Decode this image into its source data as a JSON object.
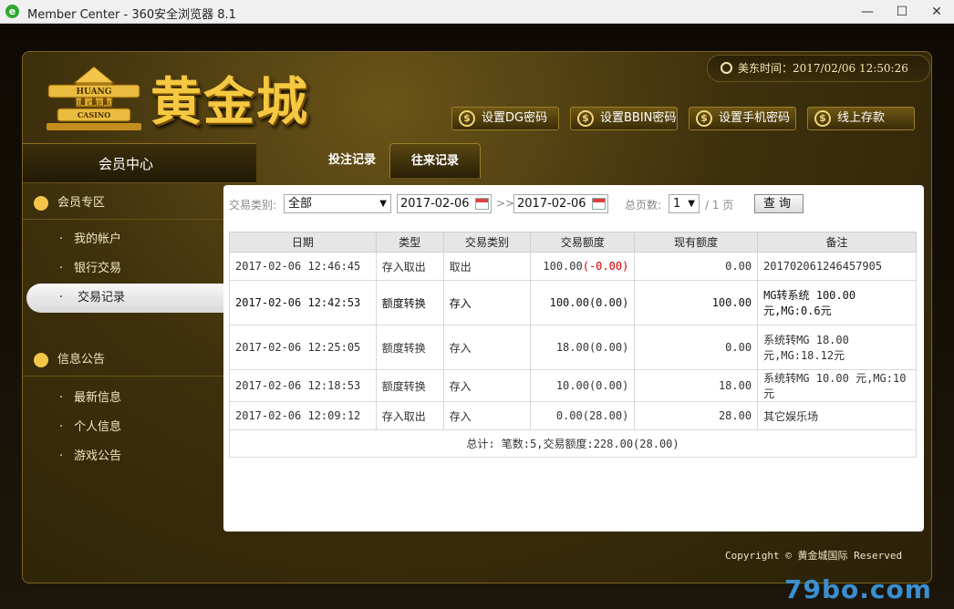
{
  "window": {
    "title": "Member Center - 360安全浏览器 8.1",
    "minimize": "—",
    "maximize": "☐",
    "close": "✕"
  },
  "header": {
    "logo_badge_lines": [
      "HUANG",
      "JIN CHENG",
      "CASINO"
    ],
    "logo_text": "黄金城",
    "time_label": "美东时间：2017/02/06 12:50:26",
    "buttons": [
      "设置DG密码",
      "设置BBIN密码",
      "设置手机密码",
      "线上存款"
    ]
  },
  "sidebar": {
    "title": "会员中心",
    "sections": [
      {
        "label": "会员专区",
        "items": [
          "我的帐户",
          "银行交易",
          "交易记录"
        ],
        "active_index": 2
      },
      {
        "label": "信息公告",
        "items": [
          "最新信息",
          "个人信息",
          "游戏公告"
        ]
      }
    ]
  },
  "tabs": [
    {
      "label": "投注记录",
      "active": false
    },
    {
      "label": "往来记录",
      "active": true
    }
  ],
  "filters": {
    "type_label": "交易类别:",
    "type_value": "全部",
    "date_from": "2017-02-06",
    "separator": ">>",
    "date_to": "2017-02-06",
    "pages_label": "总页数:",
    "page_value": "1",
    "pages_total": "/ 1 页",
    "query_button": "查询"
  },
  "table": {
    "headers": [
      "日期",
      "类型",
      "交易类别",
      "交易额度",
      "现有额度",
      "备注"
    ],
    "rows": [
      {
        "date": "2017-02-06 12:46:45",
        "type": "存入取出",
        "category": "取出",
        "amount": "100.00",
        "amount_paren": "(-0.00)",
        "balance": "0.00",
        "note": "201702061246457905"
      },
      {
        "date": "2017-02-06 12:42:53",
        "type": "额度转换",
        "category": "存入",
        "amount": "100.00",
        "amount_paren": "(0.00)",
        "balance": "100.00",
        "note": "MG转系统 100.00 元,MG:0.6元"
      },
      {
        "date": "2017-02-06 12:25:05",
        "type": "额度转换",
        "category": "存入",
        "amount": "18.00",
        "amount_paren": "(0.00)",
        "balance": "0.00",
        "note": "系统转MG 18.00 元,MG:18.12元"
      },
      {
        "date": "2017-02-06 12:18:53",
        "type": "额度转换",
        "category": "存入",
        "amount": "10.00",
        "amount_paren": "(0.00)",
        "balance": "18.00",
        "note": "系统转MG 10.00 元,MG:10元"
      },
      {
        "date": "2017-02-06 12:09:12",
        "type": "存入取出",
        "category": "存入",
        "amount": "0.00",
        "amount_paren": "(28.00)",
        "balance": "28.00",
        "note": "其它娱乐场"
      }
    ],
    "total": "总计: 笔数:5,交易额度:228.00(28.00)"
  },
  "footer": {
    "copyright": "Copyright © 黄金城国际 Reserved"
  },
  "watermark": "79bo.com",
  "colors": {
    "gold": "#f5c842",
    "negative": "#d00000"
  }
}
